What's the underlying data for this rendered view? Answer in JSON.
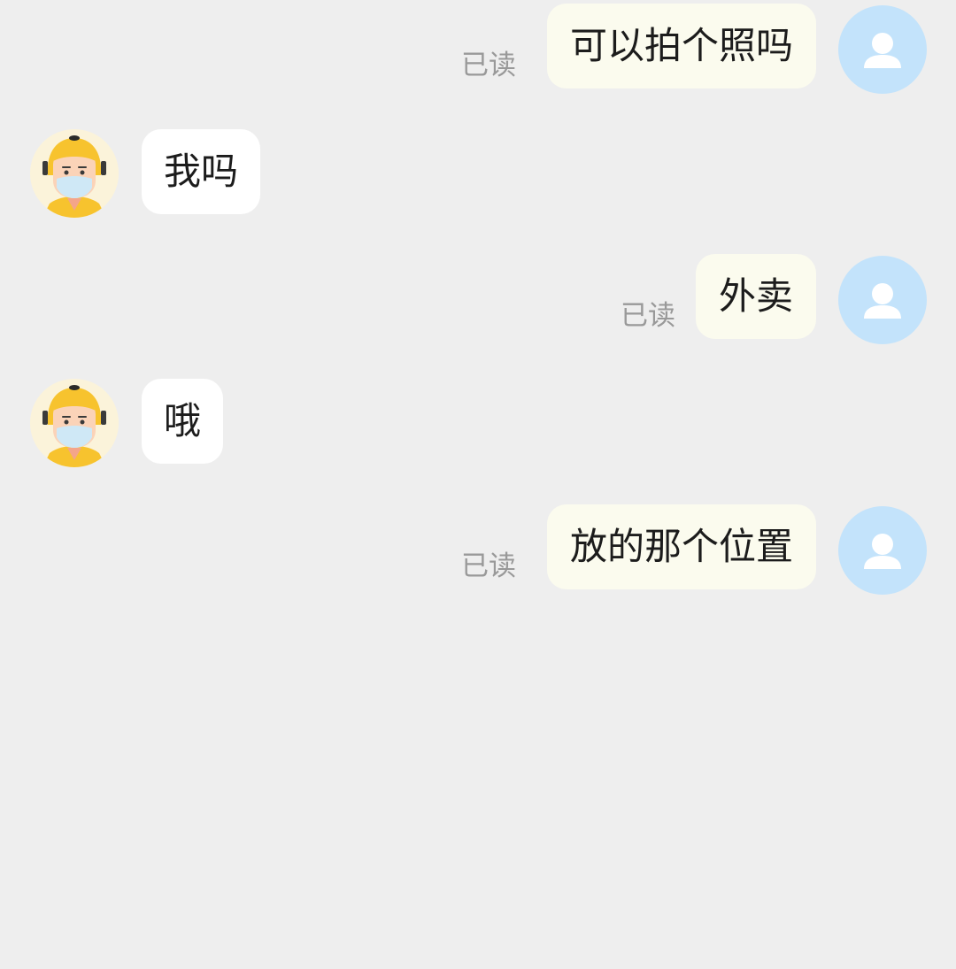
{
  "chat": {
    "read_label": "已读",
    "messages": [
      {
        "direction": "out",
        "text": "可以拍个照吗",
        "status": "已读",
        "avatar": "default-user-icon"
      },
      {
        "direction": "in",
        "text": "我吗",
        "avatar": "courier-icon"
      },
      {
        "direction": "out",
        "text": "外卖",
        "status": "已读",
        "avatar": "default-user-icon"
      },
      {
        "direction": "in",
        "text": "哦",
        "avatar": "courier-icon"
      },
      {
        "direction": "out",
        "text": "放的那个位置",
        "status": "已读",
        "avatar": "default-user-icon"
      }
    ]
  },
  "colors": {
    "background": "#eeeeee",
    "outgoing_bubble": "#fbfbee",
    "incoming_bubble": "#ffffff",
    "self_avatar_bg": "#c3e3fb",
    "status_text": "#999999",
    "courier_helmet": "#f7c32e"
  }
}
